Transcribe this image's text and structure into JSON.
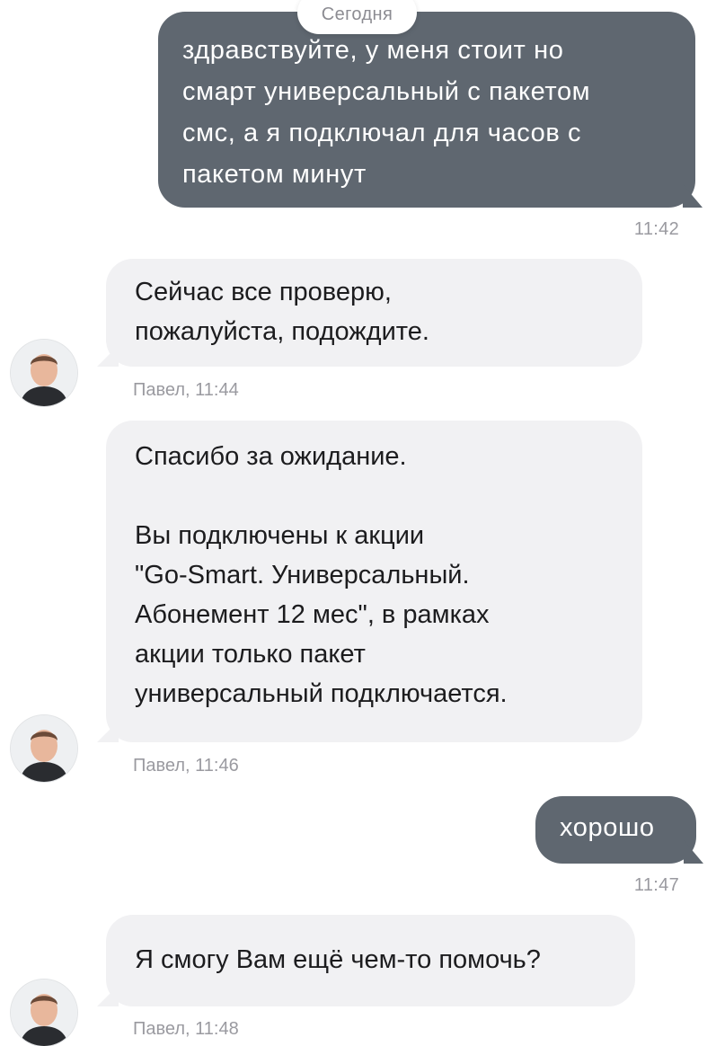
{
  "date_divider": "Сегодня",
  "messages": [
    {
      "text": "здравствуйте, у меня стоит но\nсмарт универсальный с пакетом\nсмс, а я подключал для часов с\nпакетом минут",
      "time": "11:42"
    },
    {
      "text": "Сейчас все проверю,\nпожалуйста, подождите.",
      "meta": "Павел, 11:44"
    },
    {
      "text": "Спасибо за ожидание.\n\nВы подключены к акции\n\"Go-Smart. Универсальный.\nАбонемент 12 мес\", в рамках\nакции только пакет\nуниверсальный подключается.",
      "meta": "Павел, 11:46"
    },
    {
      "text": "хорошо",
      "time": "11:47"
    },
    {
      "text": "Я смогу Вам ещё чем-то помочь?",
      "meta": "Павел, 11:48"
    }
  ],
  "colors": {
    "outgoing_bubble": "#5f6770",
    "incoming_bubble": "#f1f1f3",
    "meta_text": "#9a9aa0"
  },
  "icons": {
    "avatar": "agent-avatar-photo"
  }
}
